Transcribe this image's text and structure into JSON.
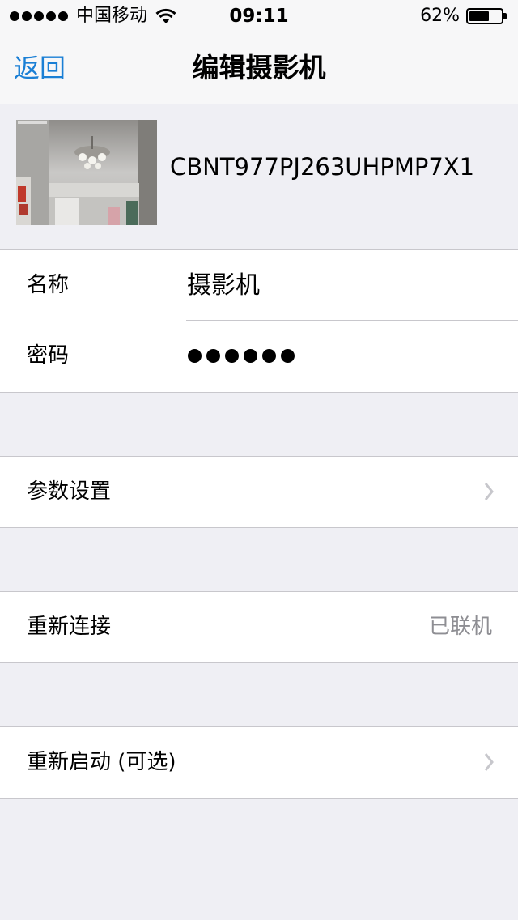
{
  "status_bar": {
    "carrier": "中国移动",
    "time": "09:11",
    "battery_percent": "62%",
    "battery_level": 0.62
  },
  "nav": {
    "back_label": "返回",
    "title": "编辑摄影机"
  },
  "camera": {
    "id": "CBNT977PJ263UHPMP7X1"
  },
  "details": {
    "name_label": "名称",
    "name_value": "摄影机",
    "password_label": "密码",
    "password_length": 6
  },
  "settings": {
    "params_label": "参数设置",
    "reconnect_label": "重新连接",
    "reconnect_status": "已联机",
    "restart_label": "重新启动 (可选)"
  },
  "colors": {
    "accent": "#1a7fd5",
    "background": "#efeff4",
    "separator": "#c8c7cc",
    "detail_text": "#8e8e93"
  }
}
